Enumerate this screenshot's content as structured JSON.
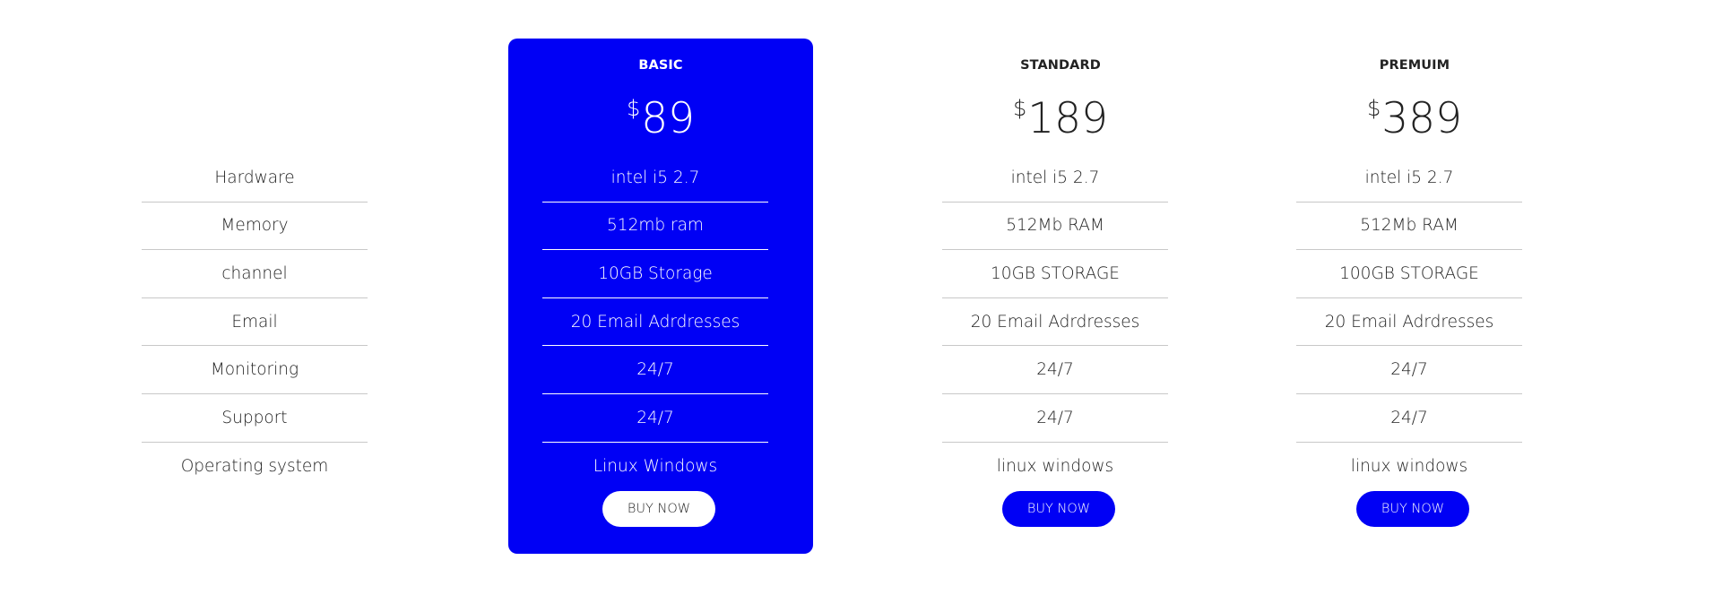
{
  "features": [
    "Hardware",
    "Memory",
    "channel",
    "Email",
    "Monitoring",
    "Support",
    "Operating system"
  ],
  "plans": [
    {
      "name": "BASIC",
      "currency": "$",
      "price": "89",
      "rows": [
        "intel i5 2.7",
        "512mb ram",
        "10GB Storage",
        "20 Email Adrdresses",
        "24/7",
        "24/7",
        "Linux Windows"
      ],
      "button": "BUY NOW"
    },
    {
      "name": "STANDARD",
      "currency": "$",
      "price": "189",
      "rows": [
        "intel i5 2.7",
        "512Mb RAM",
        "10GB STORAGE",
        "20 Email Adrdresses",
        "24/7",
        "24/7",
        "linux windows"
      ],
      "button": "BUY NOW"
    },
    {
      "name": "PREMUIM",
      "currency": "$",
      "price": "389",
      "rows": [
        "intel i5 2.7",
        "512Mb RAM",
        "100GB STORAGE",
        "20 Email Adrdresses",
        "24/7",
        "24/7",
        "linux windows"
      ],
      "button": "BUY NOW"
    }
  ],
  "colors": {
    "accent": "#0000f5",
    "text": "#222222",
    "divider": "#c8c8c8",
    "background": "#ffffff"
  }
}
